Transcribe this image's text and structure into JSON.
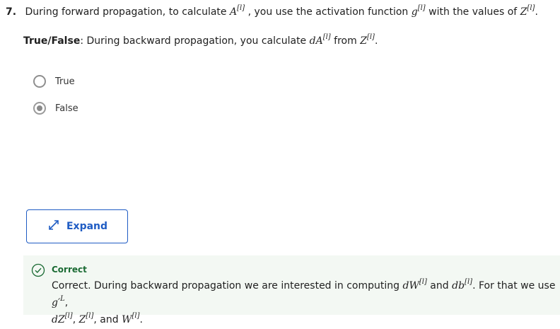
{
  "question": {
    "number": "7.",
    "text_1": "During forward propagation, to calculate ",
    "text_2": ", you use the activation function ",
    "text_3": " with the values of ",
    "text_4": "."
  },
  "statement": {
    "label": "True/False",
    "text_1": ": During backward propagation, you calculate ",
    "text_2": " from ",
    "text_3": "."
  },
  "math": {
    "A": "A",
    "g": "g",
    "Z": "Z",
    "dA": "dA",
    "dW": "dW",
    "db": "db",
    "gprime": "g′",
    "L": "L",
    "dZ": "dZ",
    "W": "W",
    "l": "[l]"
  },
  "options": [
    {
      "label": "True",
      "selected": false
    },
    {
      "label": "False",
      "selected": true
    }
  ],
  "expand": {
    "label": "Expand"
  },
  "feedback": {
    "title": "Correct",
    "text_1": "Correct. During backward propagation we are interested in computing ",
    "text_2": " and ",
    "text_3": ". For that we use ",
    "text_4": ",",
    "text_5": ", ",
    "text_6": ", and ",
    "text_7": "."
  },
  "colors": {
    "accent": "#1f5cc4",
    "success": "#1b6b34",
    "feedback_bg": "#f3f8f3"
  }
}
